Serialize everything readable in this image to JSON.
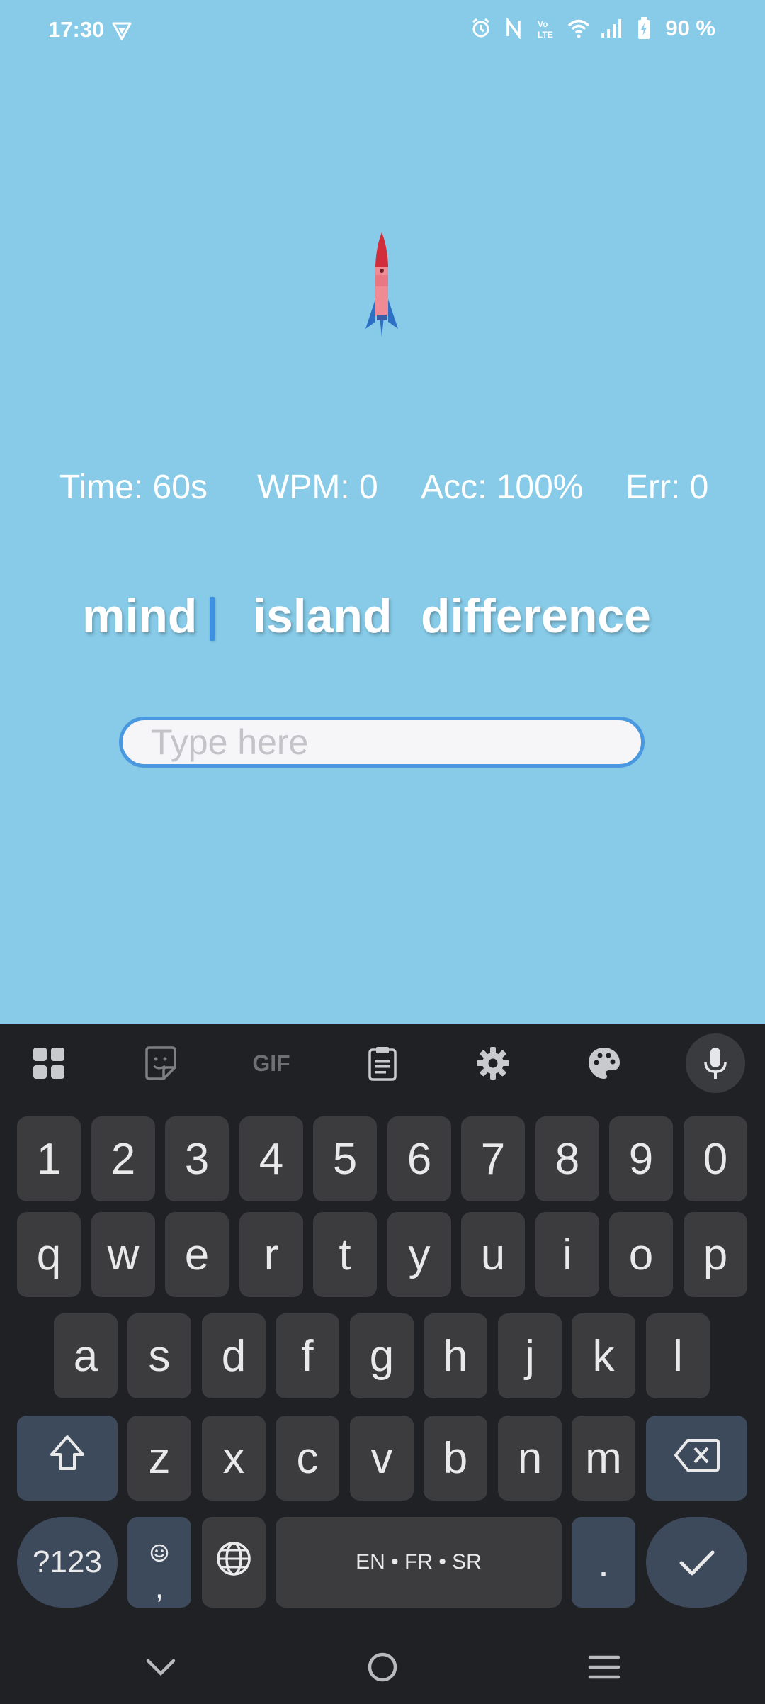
{
  "status_bar": {
    "time": "17:30",
    "battery": "90 %",
    "icons": [
      "vpn-shield-icon",
      "alarm-icon",
      "nfc-icon",
      "volte-icon",
      "wifi-icon",
      "signal-icon",
      "battery-charging-icon"
    ]
  },
  "game": {
    "stats": {
      "time": "Time: 60s",
      "wpm": "WPM: 0",
      "acc": "Acc: 100%",
      "err": "Err: 0"
    },
    "words": [
      "mind",
      "island",
      "difference"
    ],
    "input": {
      "placeholder": "Type here",
      "value": ""
    }
  },
  "keyboard": {
    "toolbar": [
      "apps-grid-icon",
      "sticker-icon",
      "gif-icon",
      "clipboard-icon",
      "settings-icon",
      "palette-icon",
      "mic-icon"
    ],
    "gif_label": "GIF",
    "row_numbers": [
      "1",
      "2",
      "3",
      "4",
      "5",
      "6",
      "7",
      "8",
      "9",
      "0"
    ],
    "row1": [
      "q",
      "w",
      "e",
      "r",
      "t",
      "y",
      "u",
      "i",
      "o",
      "p"
    ],
    "row2": [
      "a",
      "s",
      "d",
      "f",
      "g",
      "h",
      "j",
      "k",
      "l"
    ],
    "row3": [
      "z",
      "x",
      "c",
      "v",
      "b",
      "n",
      "m"
    ],
    "symbols_label": "?123",
    "comma": ",",
    "space_label": "EN • FR • SR",
    "period": "."
  },
  "nav_bar": [
    "back-chevron-icon",
    "home-circle-icon",
    "recents-menu-icon"
  ]
}
